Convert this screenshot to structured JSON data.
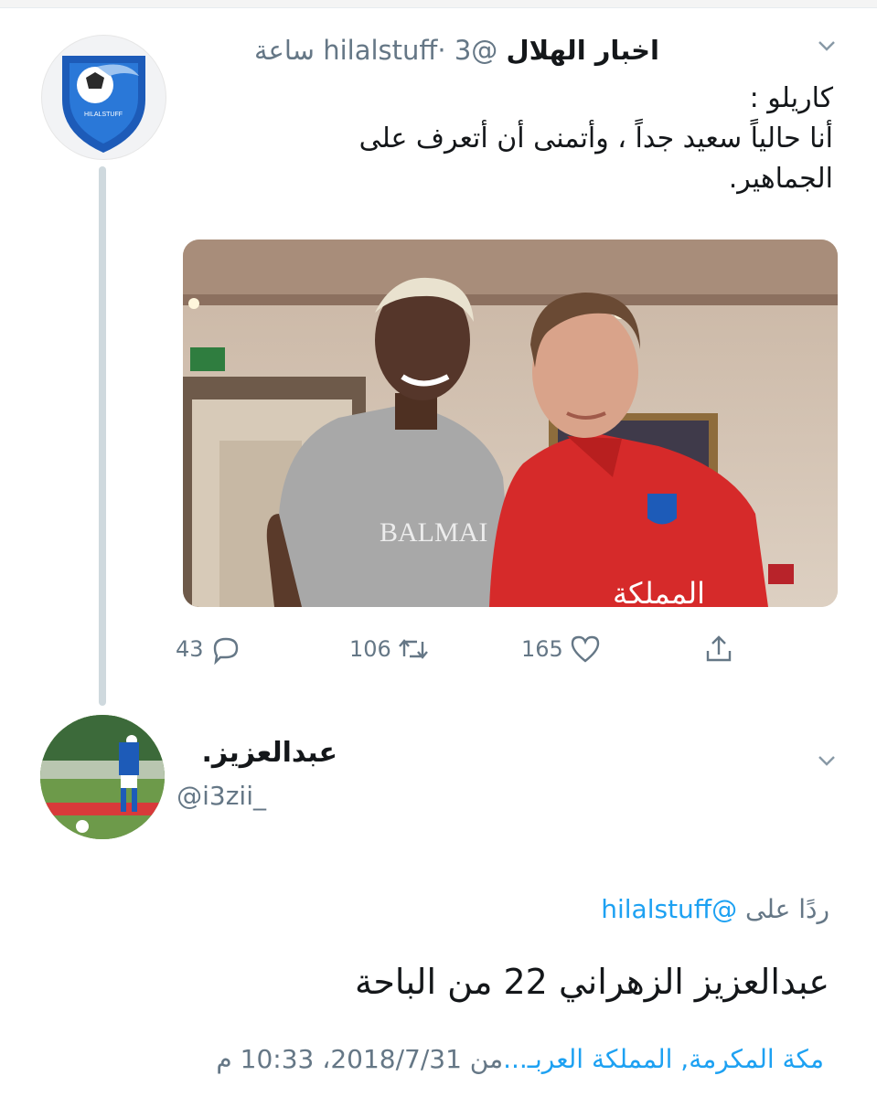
{
  "tweet1": {
    "display_name": "اخبار الهلال",
    "handle": "@hilalstuff",
    "separator": "·",
    "time": "3 ساعة",
    "text_line1": "كاريلو :",
    "text_line2": "أنا حالياً سعيد جداً ، وأتمنى أن أتعرف على",
    "text_line3": "الجماهير.",
    "photo_shirt_text": "BALMAI",
    "photo_sponsor_text": "المملكة",
    "actions": {
      "replies": "43",
      "retweets": "106",
      "likes": "165"
    }
  },
  "tweet2": {
    "display_name": "عبدالعزيز.",
    "handle": "@i3zii_",
    "reply_prefix": "ردًا على",
    "reply_to": "@hilalstuff",
    "text": "عبدالعزيز الزهراني 22 من الباحة",
    "location": "مكة المكرمة, المملكة العربـ...",
    "from_label": "من",
    "timestamp": "2018/7/31، 10:33 م"
  },
  "icons": {
    "menu": "chevron-down-icon",
    "reply": "reply-icon",
    "retweet": "retweet-icon",
    "like": "heart-icon",
    "share": "share-icon"
  },
  "colors": {
    "link": "#1da1f2",
    "muted": "#657786",
    "thread_line": "#cfd9de"
  }
}
